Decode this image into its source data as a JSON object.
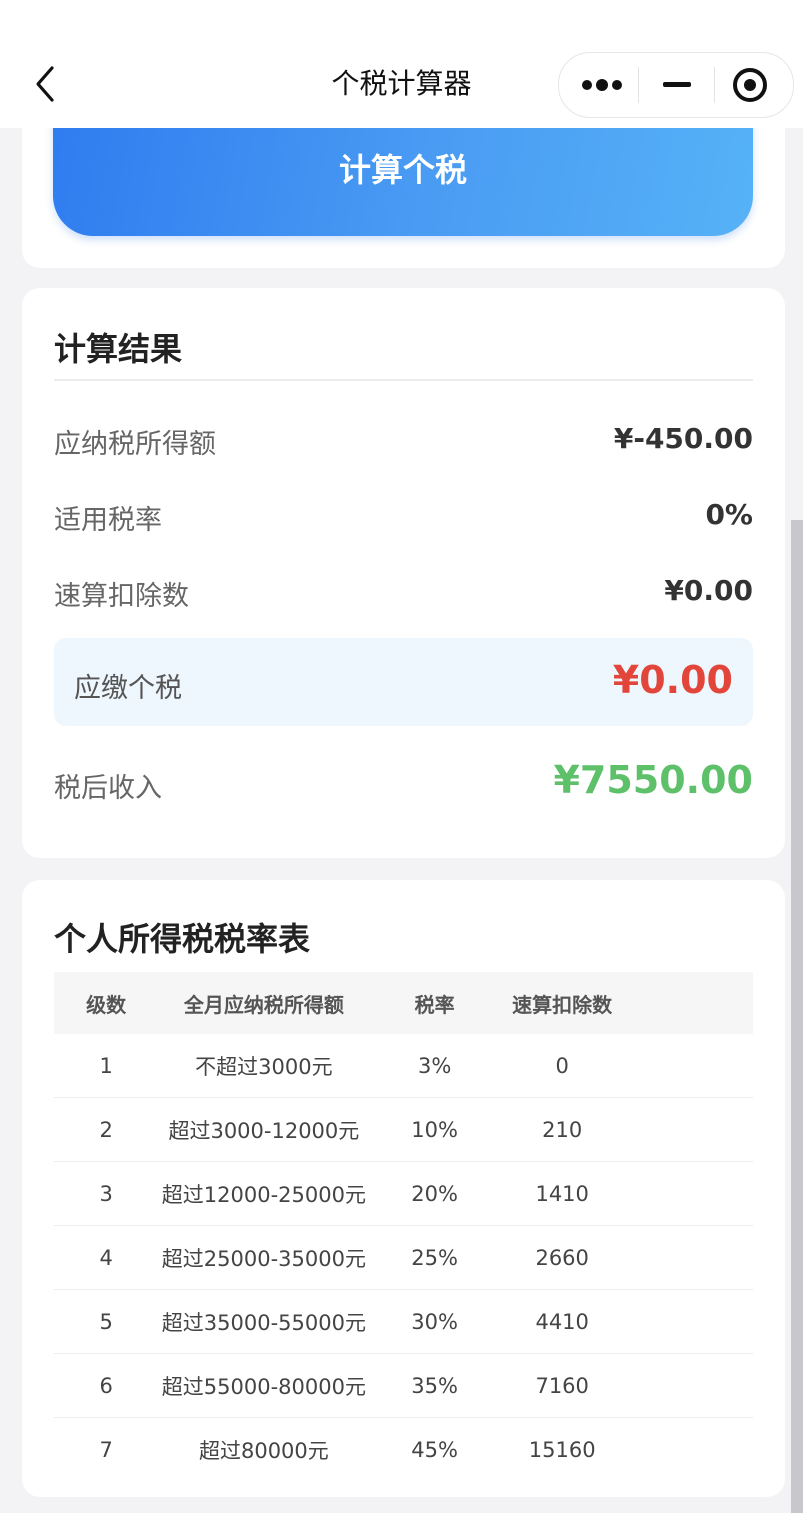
{
  "nav": {
    "title": "个税计算器",
    "back_icon": "chevron-left-icon",
    "capsule": {
      "more_icon": "more-dots-icon",
      "minimize_icon": "minimize-icon",
      "close_icon": "target-close-icon"
    }
  },
  "calc_button_label": "计算个税",
  "result": {
    "title": "计算结果",
    "taxable_income_label": "应纳税所得额",
    "taxable_income_value": "¥-450.00",
    "rate_label": "适用税率",
    "rate_value": "0%",
    "deduction_label": "速算扣除数",
    "deduction_value": "¥0.00",
    "tax_due_label": "应缴个税",
    "tax_due_value": "¥0.00",
    "net_income_label": "税后收入",
    "net_income_value": "¥7550.00"
  },
  "rate_table": {
    "title": "个人所得税税率表",
    "headers": [
      "级数",
      "全月应纳税所得额",
      "税率",
      "速算扣除数"
    ],
    "rows": [
      [
        "1",
        "不超过3000元",
        "3%",
        "0"
      ],
      [
        "2",
        "超过3000-12000元",
        "10%",
        "210"
      ],
      [
        "3",
        "超过12000-25000元",
        "20%",
        "1410"
      ],
      [
        "4",
        "超过25000-35000元",
        "25%",
        "2660"
      ],
      [
        "5",
        "超过35000-55000元",
        "30%",
        "4410"
      ],
      [
        "6",
        "超过55000-80000元",
        "35%",
        "7160"
      ],
      [
        "7",
        "超过80000元",
        "45%",
        "15160"
      ]
    ]
  },
  "colors": {
    "accent_blue": "#2f7cf0",
    "tax_red": "#e2463b",
    "net_green": "#5ec16a"
  }
}
